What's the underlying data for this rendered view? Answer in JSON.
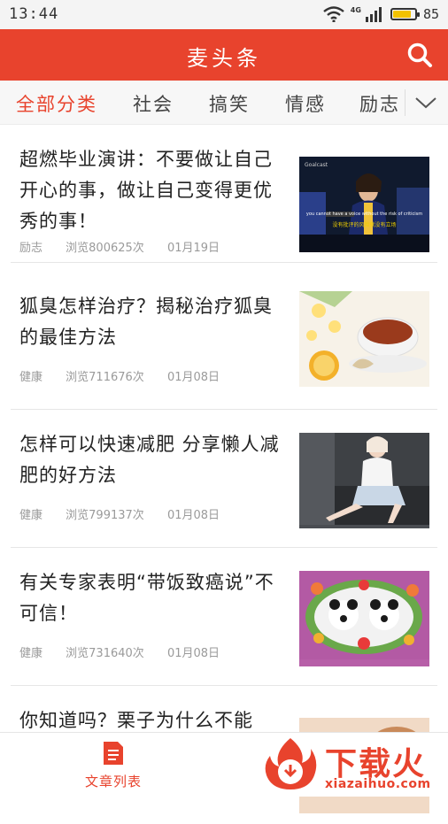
{
  "status_bar": {
    "time": "13:44",
    "network_label": "4G",
    "battery_percent": "85",
    "battery_level": 0.85
  },
  "header": {
    "title": "麦头条"
  },
  "tabs": {
    "items": [
      {
        "label": "全部分类",
        "active": true
      },
      {
        "label": "社会",
        "active": false
      },
      {
        "label": "搞笑",
        "active": false
      },
      {
        "label": "情感",
        "active": false
      },
      {
        "label": "励志",
        "active": false
      }
    ]
  },
  "articles": [
    {
      "title": "超燃毕业演讲：不要做让自己开心的事，做让自己变得更优秀的事！",
      "category": "励志",
      "views": "浏览800625次",
      "date": "01月19日",
      "thumb_caption_en": "you cannot have a voice without the risk of criticism",
      "thumb_caption_cn": "没有批评的风险就没有立场",
      "thumb_logo": "Goalcast"
    },
    {
      "title": "狐臭怎样治疗？揭秘治疗狐臭的最佳方法",
      "category": "健康",
      "views": "浏览711676次",
      "date": "01月08日"
    },
    {
      "title": "怎样可以快速减肥 分享懒人减肥的好方法",
      "category": "健康",
      "views": "浏览799137次",
      "date": "01月08日"
    },
    {
      "title": "有关专家表明“带饭致癌说”不可信！",
      "category": "健康",
      "views": "浏览731640次",
      "date": "01月08日"
    },
    {
      "title": "你知道吗？栗子为什么不能",
      "category": "",
      "views": "",
      "date": ""
    }
  ],
  "bottom_nav": {
    "article_list_label": "文章列表"
  },
  "watermark": {
    "title": "下载火",
    "url": "xiazaihuo.com"
  },
  "colors": {
    "brand_red": "#e8432d",
    "battery_yellow": "#f2c200"
  }
}
